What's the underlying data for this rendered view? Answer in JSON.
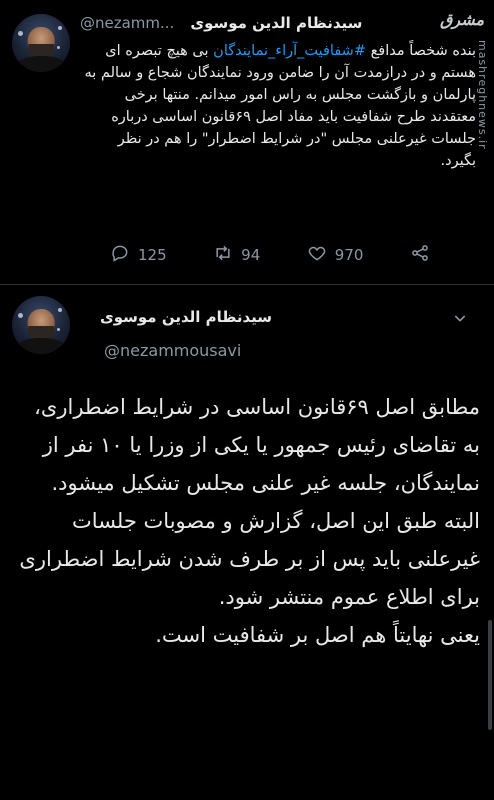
{
  "tweet1": {
    "name": "سیدنظام الدین موسوی",
    "handle": "@nezamm...",
    "text_before": "بنده شخصاً مدافع ",
    "hashtag": "#شفافیت_آراء_نمایندگان",
    "text_after": " بی هیچ تبصره ای هستم و در درازمدت آن را ضامن ورود نمایندگان شجاع و سالم به پارلمان و بازگشت مجلس به راس امور میدانم. منتها برخی معتقدند طرح شفافیت باید مفاد اصل ۶۹قانون اساسی درباره جلسات غیرعلنی مجلس \"در شرایط اضطرار\" را هم در نظر بگیرد.",
    "reply_count": "125",
    "retweet_count": "94",
    "like_count": "970",
    "icons": {
      "reply": "reply-icon",
      "retweet": "retweet-icon",
      "like": "heart-icon",
      "share": "share-icon"
    }
  },
  "tweet2": {
    "name": "سیدنظام الدین موسوی",
    "handle": "@nezammousavi",
    "paragraph1": "مطابق اصل ۶۹قانون اساسی در شرایط اضطراری، به تقاضای رئیس جمهور یا یکی از وزرا یا ۱۰ نفر از نمایندگان، جلسه غیر علنی مجلس تشکیل میشود.",
    "paragraph2": "البته طبق این اصل، گزارش و مصوبات جلسات غیرعلنی باید پس از بر طرف شدن شرایط اضطراری برای اطلاع عموم منتشر شود.",
    "paragraph3": "یعنی نهایتاً هم اصل بر شفافیت است."
  },
  "watermark": {
    "logo": "مشرق",
    "site": "mashreghnews.ir"
  }
}
